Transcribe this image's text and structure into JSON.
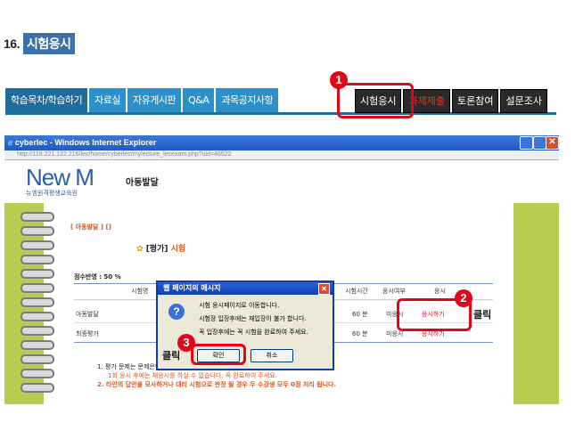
{
  "heading": {
    "number": "16.",
    "label": "시험응시"
  },
  "tabs": [
    "학습목차/학습하기",
    "자료실",
    "자유게시판",
    "Q&A",
    "과목공지사항"
  ],
  "right_buttons": [
    "시험응시",
    "과제제출",
    "토론참여",
    "설문조사"
  ],
  "ie": {
    "title": "cyberlec - Windows Internet Explorer",
    "address": "http://118.221.122.216/lec/home/cyberlec/mylecture_lecexam.php?uid=46522",
    "logo_main": "New M",
    "logo_sub": "뉴엠원격평생교육원",
    "course": "아동발달",
    "breadcrumb": "[ 아동발달 ]  []",
    "section_title_prefix": "[평가]",
    "section_title": "시험",
    "score_ratio": "점수반영 : 50 %",
    "table": {
      "headers": [
        "시험명",
        "시험시간",
        "응시여부",
        "응시"
      ],
      "rows": [
        {
          "name": "아동발달",
          "time": "60 분",
          "status": "미응시",
          "action": "응시하기"
        },
        {
          "name": "최종평가",
          "time": "60 분",
          "status": "미응시",
          "action": "응시하기"
        }
      ]
    },
    "notes": [
      "1.  평가 문제는 문제은행에서 무작위로 출제 됩니다.",
      "1회 응시 후에는 재응시를 하실 수 없습니다. 꼭 완료하여 주세요.",
      "2.  타인의 답안을 모사하거나 대리 시험으로 판정 될 경우 두 수강생 모두 0점 처리 됩니다."
    ]
  },
  "dialog": {
    "title": "웹 페이지의 메시지",
    "lines": [
      "시험 응시페이지로 이동합니다.",
      "시험장 입장후에는 재입장이 불가 합니다.",
      "꼭 입장후에는 꼭 시험을 완료하여 주세요."
    ],
    "ok": "확인",
    "cancel": "취소"
  },
  "annotations": {
    "badge1": "1",
    "badge2": "2",
    "badge3": "3",
    "click": "클릭"
  },
  "colors": {
    "tab": "#2c91c8",
    "tab_active": "#1d6e9f",
    "highlight": "#e0071b",
    "ie_frame": "#b9cc50"
  }
}
